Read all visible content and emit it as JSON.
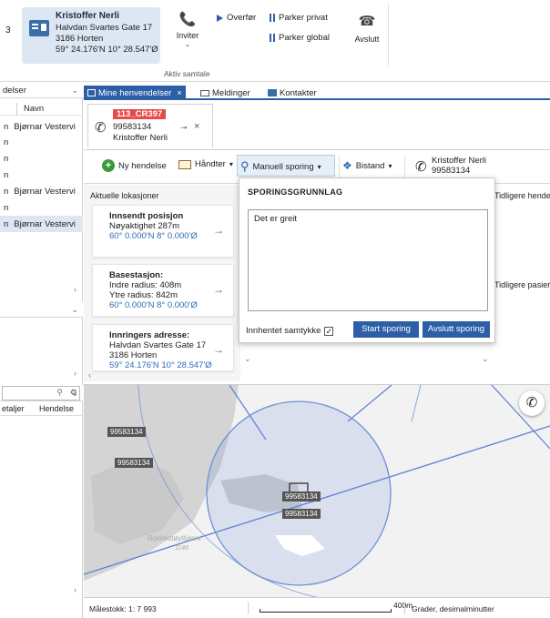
{
  "ribbon": {
    "lead_digit": "3",
    "caller": {
      "name": "Kristoffer Nerli",
      "address": "Halvdan Svartes Gate 17",
      "city": "3186 Horten",
      "coords": "59° 24.176'N 10° 28.547'Ø"
    },
    "invite_label": "Inviter",
    "transfer_label": "Overfør",
    "park_private_label": "Parker privat",
    "park_global_label": "Parker global",
    "end_label": "Avslutt",
    "group_label": "Aktiv samtale"
  },
  "left_pane": {
    "header_label": "delser",
    "column_name": "Navn",
    "rows": [
      {
        "prefix": "n",
        "name": "Bjørnar Vestervi",
        "selected": false
      },
      {
        "prefix": "n",
        "name": "",
        "selected": false
      },
      {
        "prefix": "n",
        "name": "",
        "selected": false
      },
      {
        "prefix": "n",
        "name": "",
        "selected": false
      },
      {
        "prefix": "n",
        "name": "Bjørnar Vestervi",
        "selected": false
      },
      {
        "prefix": "n",
        "name": "",
        "selected": false
      },
      {
        "prefix": "n",
        "name": "Bjørnar Vestervi",
        "selected": true
      }
    ],
    "search_placeholder": "",
    "details_col": "etaljer",
    "hendelse_col": "Hendelse"
  },
  "tabs": [
    {
      "label": "Mine henvendelser",
      "active": true
    },
    {
      "label": "Meldinger",
      "active": false
    },
    {
      "label": "Kontakter",
      "active": false
    }
  ],
  "case_tab": {
    "id": "113_CR397",
    "phone": "99583134",
    "name": "Kristoffer Nerli"
  },
  "toolbar": {
    "new_event": "Ny hendelse",
    "handle": "Håndter",
    "manual_tracking": "Manuell sporing",
    "assist": "Bistand",
    "contact_name": "Kristoffer  Nerli",
    "contact_phone": "99583134"
  },
  "locations": {
    "header": "Aktuelle lokasjoner",
    "cards": [
      {
        "title": "Innsendt posisjon",
        "lines": [
          "Nøyaktighet 287m"
        ],
        "coords": "60° 0.000'N 8° 0.000'Ø"
      },
      {
        "title": "Basestasjon:",
        "lines": [
          "Indre radius: 408m",
          "Ytre radius: 842m"
        ],
        "coords": "60° 0.000'N 8° 0.000'Ø"
      },
      {
        "title": "Innringers adresse:",
        "lines": [
          "Halvdan Svartes Gate 17",
          "3186 Horten"
        ],
        "coords": "59° 24.176'N 10° 28.547'Ø"
      }
    ]
  },
  "right_pane": {
    "prev_events": "Tidligere hende",
    "prev_patients": "Tidligere pasier"
  },
  "popup": {
    "title": "SPORINGSGRUNNLAG",
    "text": "Det er greit",
    "consent_label": "Innhentet samtykke",
    "consent_checked": true,
    "start_label": "Start sporing",
    "end_label": "Avslutt sporing"
  },
  "map": {
    "labels": [
      "99583134",
      "99583134",
      "99583134",
      "99583134"
    ],
    "place_name": "Bokkestøyltjønni",
    "place_elev": "1148"
  },
  "statusbar": {
    "scale": "Målestokk: 1: 7 993",
    "scale_dist": "400m",
    "format": "Grader, desimalminutter"
  },
  "colors": {
    "accent": "#2d5fa6",
    "case_badge": "#e84a4a",
    "selection": "#dde7f3",
    "map_circle": "#6a8fd8"
  }
}
